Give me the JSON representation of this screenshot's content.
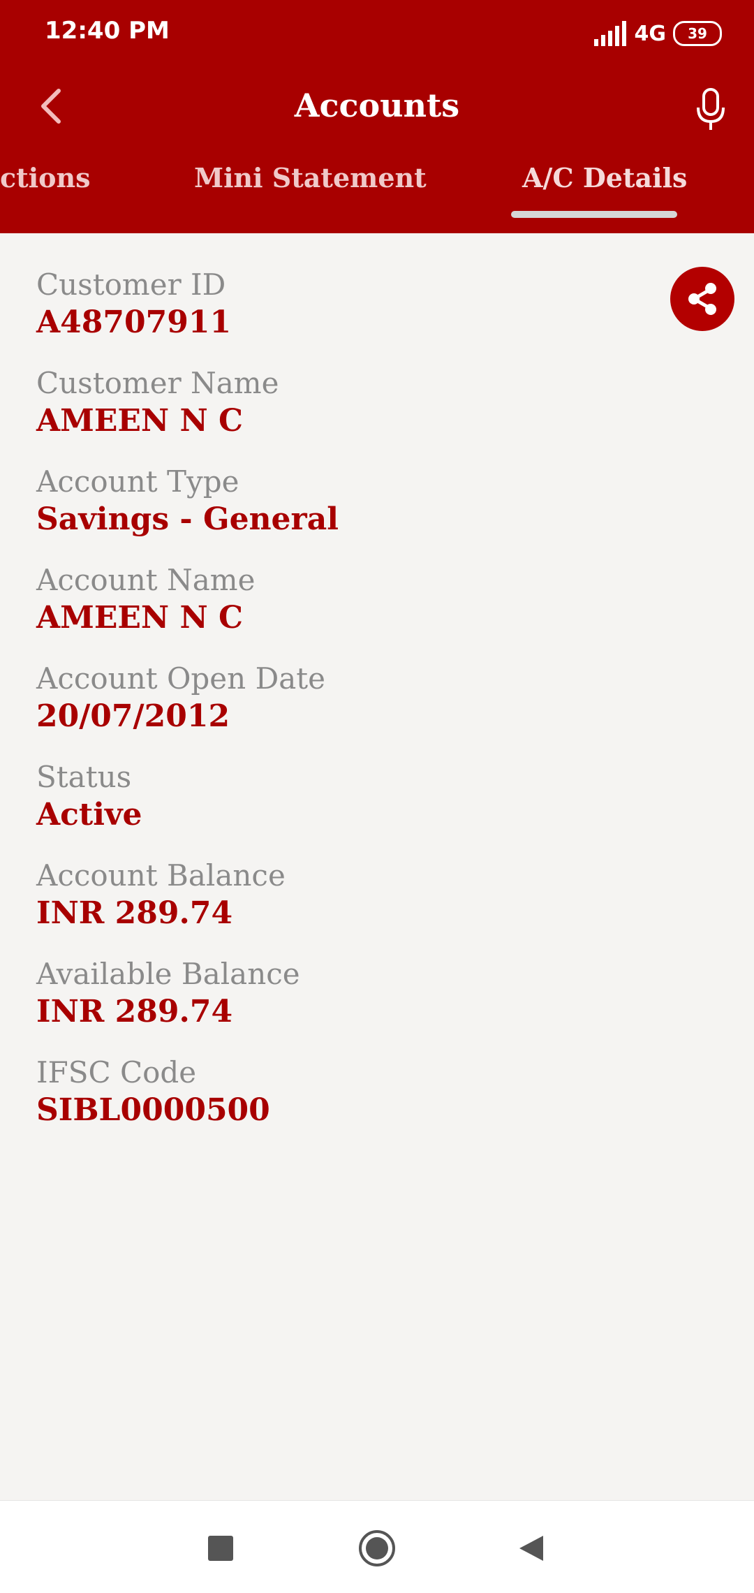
{
  "status_bar": {
    "time": "12:40 PM",
    "network": "4G",
    "battery": "39"
  },
  "toolbar": {
    "title": "Accounts",
    "back_icon": "chevron-left-icon",
    "mic_icon": "microphone-icon"
  },
  "tabs": [
    {
      "label": "ctions",
      "active": false
    },
    {
      "label": "Mini Statement",
      "active": false
    },
    {
      "label": "A/C Details",
      "active": true
    }
  ],
  "details": [
    {
      "label": "Customer ID",
      "value": "A48707911"
    },
    {
      "label": "Customer Name",
      "value": "AMEEN N C"
    },
    {
      "label": "Account Type",
      "value": "Savings - General"
    },
    {
      "label": "Account Name",
      "value": "AMEEN N C"
    },
    {
      "label": "Account Open Date",
      "value": "20/07/2012"
    },
    {
      "label": "Status",
      "value": "Active"
    },
    {
      "label": "Account Balance",
      "value": "INR 289.74"
    },
    {
      "label": "Available Balance",
      "value": "INR 289.74"
    },
    {
      "label": "IFSC Code",
      "value": "SIBL0000500"
    }
  ],
  "share_icon": "share-icon",
  "nav": [
    "recent-apps-icon",
    "home-icon",
    "back-icon"
  ],
  "colors": {
    "header": "#a80000",
    "value_text": "#a80000",
    "label_text": "#8a8a8a",
    "background": "#f5f4f2"
  }
}
